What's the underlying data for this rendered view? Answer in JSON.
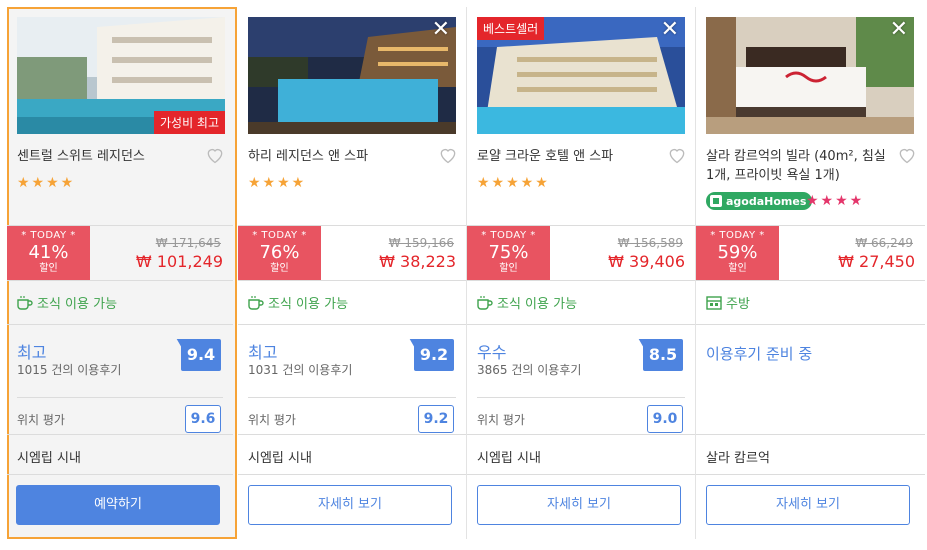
{
  "colors": {
    "accent": "#4e84e0",
    "sale": "#e4262b",
    "today": "#e85461",
    "amenity": "#3fa34d",
    "selected_border": "#f6a337"
  },
  "cards": [
    {
      "name": "센트럴 스위트 레지던스",
      "photo_badge": "가성비 최고",
      "stars": "★★★★",
      "today_label": "* TODAY *",
      "discount": "41%",
      "discount_suffix": "할인",
      "original_price": "₩ 171,645",
      "final_price": "₩ 101,249",
      "amenity": "조식 이용 가능",
      "amenity_icon": "coffee-cup-icon",
      "review_label": "최고",
      "review_count": "1015 건의 이용후기",
      "score": "9.4",
      "location_label": "위치 평가",
      "location_score": "9.6",
      "area": "시엠립 시내",
      "button": "예약하기"
    },
    {
      "name": "하리 레지던스 앤 스파",
      "stars": "★★★★",
      "today_label": "* TODAY *",
      "discount": "76%",
      "discount_suffix": "할인",
      "original_price": "₩ 159,166",
      "final_price": "₩ 38,223",
      "amenity": "조식 이용 가능",
      "amenity_icon": "coffee-cup-icon",
      "review_label": "최고",
      "review_count": "1031 건의 이용후기",
      "score": "9.2",
      "location_label": "위치 평가",
      "location_score": "9.2",
      "area": "시엠립 시내",
      "button": "자세히 보기"
    },
    {
      "name": "로얄 크라운 호텔 앤 스파",
      "photo_badge": "베스트셀러",
      "stars": "★★★★★",
      "today_label": "* TODAY *",
      "discount": "75%",
      "discount_suffix": "할인",
      "original_price": "₩ 156,589",
      "final_price": "₩ 39,406",
      "amenity": "조식 이용 가능",
      "amenity_icon": "coffee-cup-icon",
      "review_label": "우수",
      "review_count": "3865 건의 이용후기",
      "score": "8.5",
      "location_label": "위치 평가",
      "location_score": "9.0",
      "area": "시엠립 시내",
      "button": "자세히 보기"
    },
    {
      "name": "살라 캄르억의 빌라 (40m², 침실 1개, 프라이빗 욕실 1개)",
      "agoda_badge": "agodaHomes",
      "stars": "★★★★",
      "today_label": "* TODAY *",
      "discount": "59%",
      "discount_suffix": "할인",
      "original_price": "₩ 66,249",
      "final_price": "₩ 27,450",
      "amenity": "주방",
      "amenity_icon": "kitchen-icon",
      "review_pending": "이용후기 준비 중",
      "area": "살라 캄르억",
      "button": "자세히 보기"
    }
  ]
}
